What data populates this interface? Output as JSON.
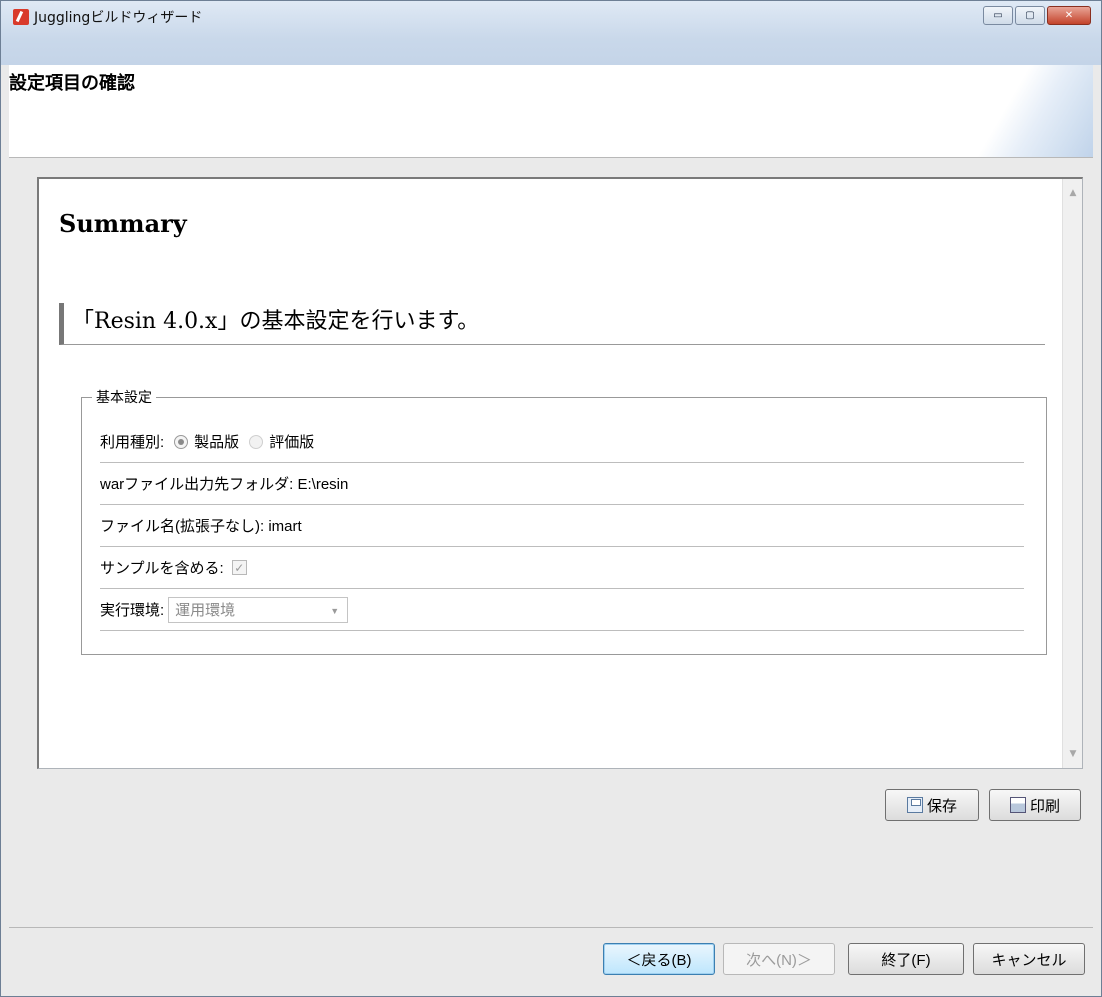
{
  "window": {
    "title": "Jugglingビルドウィザード",
    "controls": {
      "minimize": "▭",
      "maximize": "▢",
      "close": "✕"
    }
  },
  "header": {
    "heading": "設定項目の確認"
  },
  "summary": {
    "title": "Summary",
    "section_title": "「Resin 4.0.x」の基本設定を行います。",
    "fieldset_legend": "基本設定",
    "usage_type": {
      "label": "利用種別:",
      "options": [
        "製品版",
        "評価版"
      ],
      "selected": "製品版"
    },
    "war_folder": "warファイル出力先フォルダ: E:\\resin",
    "file_name": "ファイル名(拡張子なし): imart",
    "include_sample": {
      "label": "サンプルを含める:",
      "checked": true,
      "check_glyph": "✓"
    },
    "environment": {
      "label": "実行環境:",
      "value": "運用環境",
      "caret": "▼"
    }
  },
  "scrollbar": {
    "up": "▲",
    "down": "▼"
  },
  "actions": {
    "save": "保存",
    "print": "印刷"
  },
  "footer": {
    "back": "＜戻る(B)",
    "next": "次へ(N)＞",
    "finish": "終了(F)",
    "cancel": "キャンセル"
  }
}
